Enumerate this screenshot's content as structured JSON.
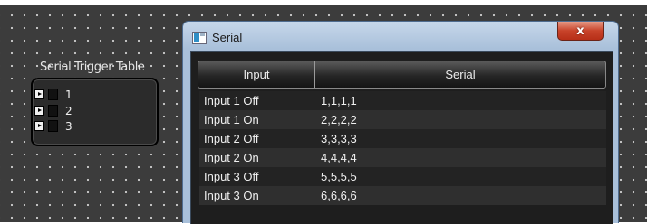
{
  "block": {
    "title": "Serial Trigger Table",
    "ports": [
      {
        "label": "1"
      },
      {
        "label": "2"
      },
      {
        "label": "3"
      }
    ]
  },
  "window": {
    "title": "Serial",
    "close_label": "x"
  },
  "table": {
    "headers": [
      "Input",
      "Serial"
    ],
    "rows": [
      {
        "input": "Input 1 Off",
        "serial": "1,1,1,1"
      },
      {
        "input": "Input 1 On",
        "serial": "2,2,2,2"
      },
      {
        "input": "Input 2 Off",
        "serial": "3,3,3,3"
      },
      {
        "input": "Input 2 On",
        "serial": "4,4,4,4"
      },
      {
        "input": "Input 3 Off",
        "serial": "5,5,5,5"
      },
      {
        "input": "Input 3 On",
        "serial": "6,6,6,6"
      }
    ]
  }
}
